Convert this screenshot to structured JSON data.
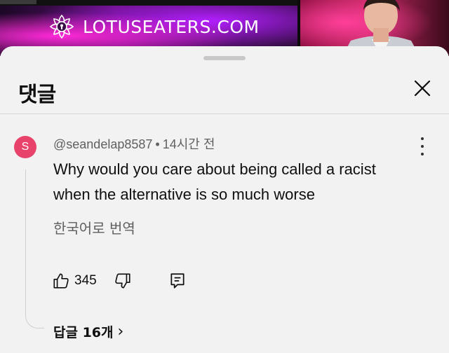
{
  "video": {
    "logo_text": "LOTUSEATERS.COM",
    "colors": {
      "panel_left": "#5d0f6f",
      "panel_right": "#c82a66"
    }
  },
  "sheet": {
    "title": "댓글",
    "close_icon": "close-icon"
  },
  "comment": {
    "avatar_letter": "S",
    "avatar_color": "#e8436b",
    "author": "@seandelap8587",
    "separator": "•",
    "time": "14시간 전",
    "text_lines": [
      "Why would you care about being called a racist",
      "when the alternative is so much worse"
    ],
    "translate_label": "한국어로 번역",
    "likes": "345",
    "icons": {
      "like": "thumbs-up-icon",
      "dislike": "thumbs-down-icon",
      "reply": "reply-icon",
      "menu": "more-vert-icon"
    },
    "replies_label": "답글 16개",
    "replies_chevron": "›"
  }
}
